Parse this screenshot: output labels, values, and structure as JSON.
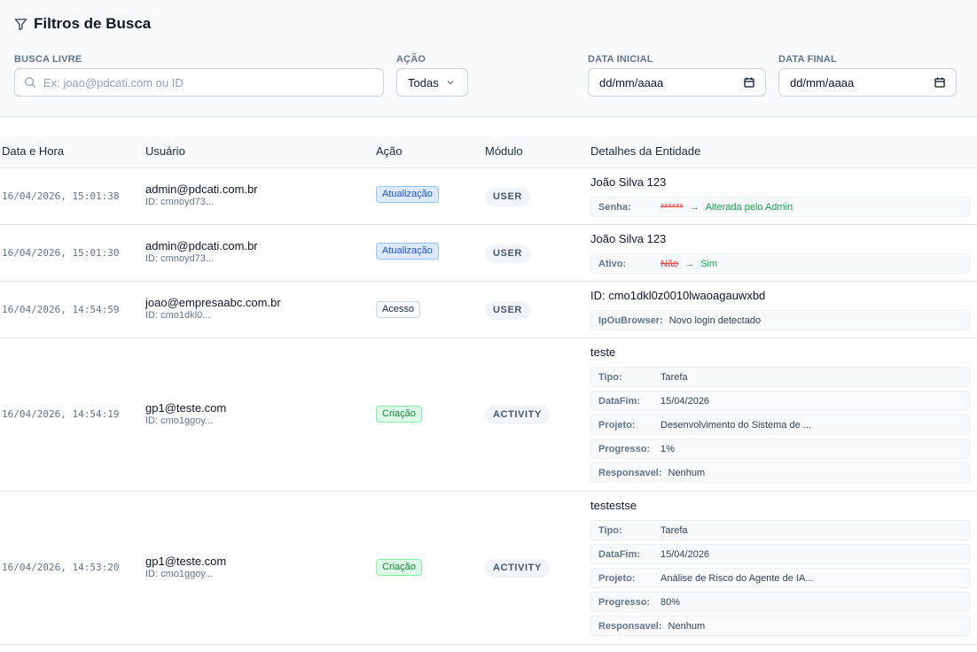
{
  "filters": {
    "title": "Filtros de Busca",
    "search_label": "BUSCA LIVRE",
    "search_placeholder": "Ex: joao@pdcati.com ou ID",
    "action_label": "AÇÃO",
    "action_value": "Todas",
    "start_label": "DATA INICIAL",
    "start_value": "dd/mm/aaaa",
    "end_label": "DATA FINAL",
    "end_value": "dd/mm/aaaa"
  },
  "table": {
    "headers": [
      "Data e Hora",
      "Usuário",
      "Ação",
      "Módulo",
      "Detalhes da Entidade"
    ],
    "rows": [
      {
        "time": "16/04/2026, 15:01:38",
        "email": "admin@pdcati.com.br",
        "uid": "ID: cmnoyd73...",
        "action": "Atualização",
        "module": "USER",
        "entity": "João Silva 123",
        "details": [
          {
            "key": "Senha:",
            "old": "******",
            "arrow": "→",
            "new": "Alterada pelo Admin"
          }
        ]
      },
      {
        "time": "16/04/2026, 15:01:30",
        "email": "admin@pdcati.com.br",
        "uid": "ID: cmnoyd73...",
        "action": "Atualização",
        "module": "USER",
        "entity": "João Silva 123",
        "details": [
          {
            "key": "Ativo:",
            "old": "Não",
            "arrow": "→",
            "new": "Sim"
          }
        ]
      },
      {
        "time": "16/04/2026, 14:54:59",
        "email": "joao@empresaabc.com.br",
        "uid": "ID: cmo1dkl0...",
        "action": "Acesso",
        "module": "USER",
        "entity": "ID: cmo1dkl0z0010lwaoagauwxbd",
        "details": [
          {
            "key": "IpOuBrowser:",
            "value": "Novo login detectado"
          }
        ]
      },
      {
        "time": "16/04/2026, 14:54:19",
        "email": "gp1@teste.com",
        "uid": "ID: cmo1ggoy...",
        "action": "Criação",
        "module": "ACTIVITY",
        "entity": "teste",
        "details": [
          {
            "key": "Tipo:",
            "value": "Tarefa"
          },
          {
            "key": "DataFim:",
            "value": "15/04/2026"
          },
          {
            "key": "Projeto:",
            "value": "Desenvolvimento do Sistema de ..."
          },
          {
            "key": "Progresso:",
            "value": "1%"
          },
          {
            "key": "Responsavel:",
            "value": "Nenhum"
          }
        ]
      },
      {
        "time": "16/04/2026, 14:53:20",
        "email": "gp1@teste.com",
        "uid": "ID: cmo1ggoy...",
        "action": "Criação",
        "module": "ACTIVITY",
        "entity": "testestse",
        "details": [
          {
            "key": "Tipo:",
            "value": "Tarefa"
          },
          {
            "key": "DataFim:",
            "value": "15/04/2026"
          },
          {
            "key": "Projeto:",
            "value": "Análise de Risco do Agente de IA..."
          },
          {
            "key": "Progresso:",
            "value": "80%"
          },
          {
            "key": "Responsavel:",
            "value": "Nenhum"
          }
        ]
      }
    ]
  },
  "colors": {
    "update_badge": "#dbeafe",
    "create_badge": "#dcfce7",
    "old_value": "#ef4444",
    "new_value": "#16a34a"
  }
}
